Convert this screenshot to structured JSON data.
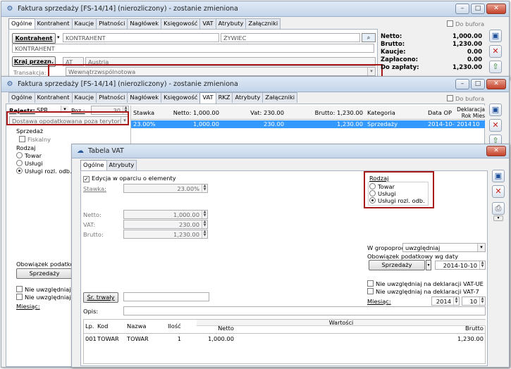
{
  "w1": {
    "title": "Faktura sprzedaży [FS-14/14] (nierozliczony) - zostanie zmieniona",
    "tabs": [
      "Ogólne",
      "Kontrahent",
      "Kaucje",
      "Płatności",
      "Nagłówek",
      "Księgowość",
      "VAT",
      "Atrybuty",
      "Załączniki"
    ],
    "do_bufora": "Do bufora",
    "kontrahent_btn": "Kontrahent",
    "kontrahent_code": "KONTRAHENT",
    "kontrahent_city": "ŻYWIEC",
    "kontrahent_name": "KONTRAHENT",
    "kraj_btn": "Kraj przezn.",
    "kraj_code": "AT",
    "kraj_name": "Austria",
    "transakcja_label": "Transakcja:",
    "transakcja_value": "Wewnątrzwspólnotowa",
    "summary": [
      {
        "label": "Netto:",
        "value": "1,000.00"
      },
      {
        "label": "Brutto:",
        "value": "1,230.00"
      },
      {
        "label": "Kaucje:",
        "value": "0.00"
      },
      {
        "label": "Zapłacono:",
        "value": "0.00"
      },
      {
        "label": "Do zapłaty:",
        "value": "1,230.00"
      }
    ]
  },
  "w2": {
    "title": "Faktura sprzedaży [FS-14/14] (nierozliczony) - zostanie zmieniona",
    "tabs": [
      "Ogólne",
      "Kontrahent",
      "Kaucje",
      "Płatności",
      "Nagłówek",
      "Księgowość",
      "VAT",
      "RKZ",
      "Atrybuty",
      "Załączniki"
    ],
    "do_bufora": "Do bufora",
    "rejestr_label": "Rejestr:",
    "rejestr_value": "SPR",
    "poz_label": "Poz.:",
    "poz_value": "30",
    "dostawa_value": "Dostawa opodatkowana poza terytorium kra",
    "sprzedaz": "Sprzedaż",
    "fiskalny": "Fiskalny",
    "rodzaj": "Rodzaj",
    "radio_towar": "Towar",
    "radio_uslugi": "Usługi",
    "radio_uslugi_rozl": "Usługi rozl. odb.",
    "obowiazek": "Obowiązek podatkowy w",
    "sprzedazy_btn": "Sprzedaży",
    "nie_uwzgl1": "Nie uwzględniaj na d",
    "nie_uwzgl2": "Nie uwzględniaj na d",
    "miesiac": "Miesiąc:",
    "grid_headers": {
      "stawka": "Stawka",
      "netto": "Netto: 1,000.00",
      "vat": "Vat: 230.00",
      "brutto": "Brutto: 1,230.00",
      "kategoria": "Kategoria",
      "data_op": "Data OP",
      "deklaracja": "Deklaracja",
      "rok": "Rok",
      "mies": "Mies"
    },
    "grid_row": {
      "stawka": "23.00%",
      "netto": "1,000.00",
      "vat": "230.00",
      "brutto": "1,230.00",
      "kategoria": "Sprzedaży",
      "data_op": "2014-10-10",
      "rok": "2014",
      "mies": "10"
    }
  },
  "w3": {
    "title": "Tabela VAT",
    "tabs": [
      "Ogólne",
      "Atrybuty"
    ],
    "edycja": "Edycja w oparciu o elementy",
    "stawka_label": "Stawka:",
    "stawka_value": "23.00%",
    "netto_label": "Netto:",
    "netto_value": "1,000.00",
    "vat_label": "VAT:",
    "vat_value": "230.00",
    "brutto_label": "Brutto:",
    "brutto_value": "1,230.00",
    "rodzaj": "Rodzaj",
    "radio_towar": "Towar",
    "radio_uslugi": "Usługi",
    "radio_uslugi_rozl": "Usługi rozl. odb.",
    "w_gropoprocji_label": "W gropoprocji:",
    "w_gropoprocji_value": "uwzględniaj",
    "obowiazek": "Obowiązek podatkowy wg daty",
    "sprzedazy_btn": "Sprzedaży",
    "data_value": "2014-10-10",
    "nie_vatue": "Nie uwzględniaj na deklaracji VAT-UE",
    "nie_vat7": "Nie uwzględniaj na deklaracji VAT-7",
    "miesiac_label": "Miesiąc:",
    "rok_value": "2014",
    "mies_value": "10",
    "sr_trwaly": "Śr. trwały",
    "opis_label": "Opis:",
    "table_headers": {
      "lp": "Lp.",
      "kod": "Kod",
      "nazwa": "Nazwa",
      "ilosc": "Ilość",
      "wartosci": "Wartości",
      "netto": "Netto",
      "brutto": "Brutto"
    },
    "table_row": {
      "lp": "001",
      "kod": "TOWAR",
      "nazwa": "TOWAR",
      "ilosc": "1",
      "netto": "1,000.00",
      "brutto": "1,230.00"
    }
  }
}
